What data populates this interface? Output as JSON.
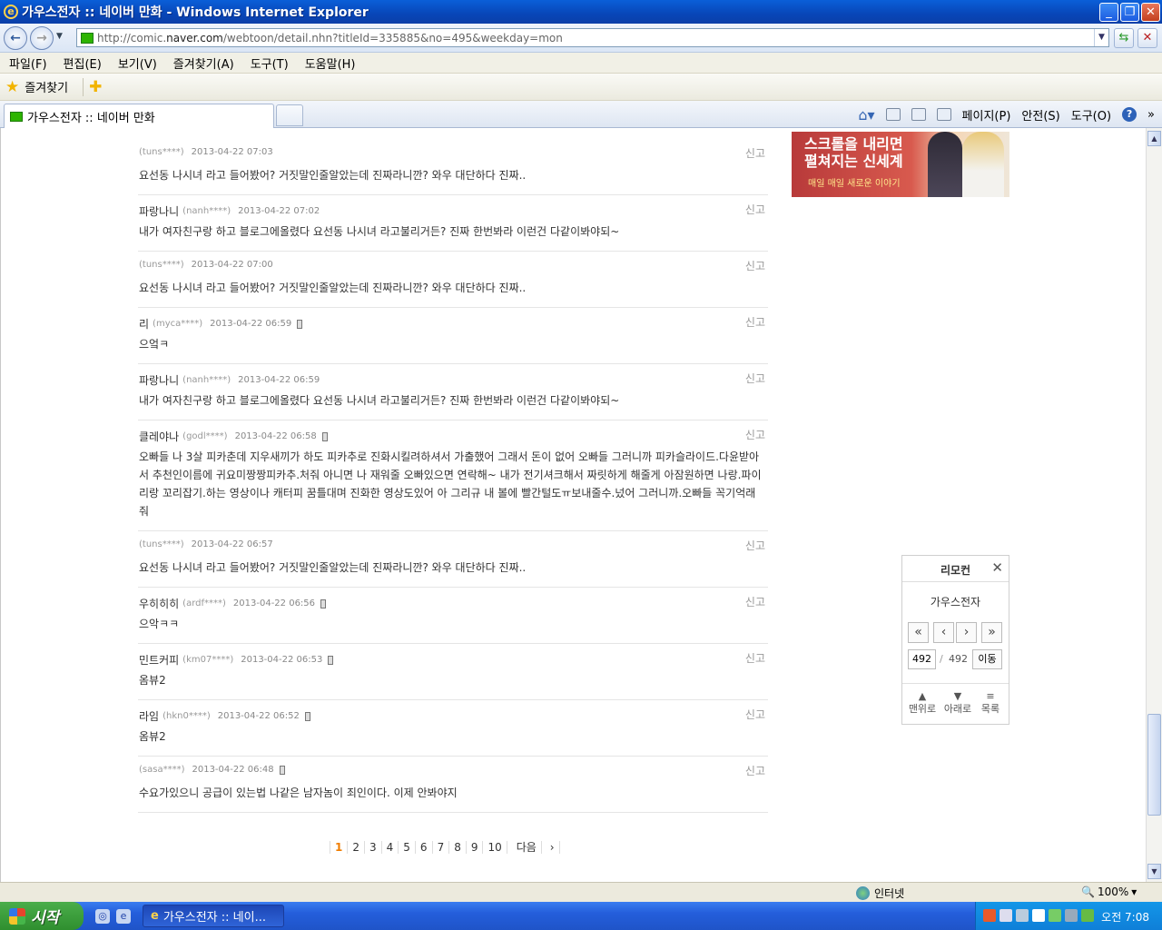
{
  "window": {
    "title": "가우스전자 :: 네이버 만화 - Windows Internet Explorer"
  },
  "address": {
    "url_prefix": "http://comic.",
    "url_domain": "naver.com",
    "url_suffix": "/webtoon/detail.nhn?titleId=335885&no=495&weekday=mon"
  },
  "menu": [
    "파일(F)",
    "편집(E)",
    "보기(V)",
    "즐겨찾기(A)",
    "도구(T)",
    "도움말(H)"
  ],
  "favorites": {
    "label": "즐겨찾기"
  },
  "tab": {
    "title": "가우스전자 :: 네이버 만화"
  },
  "commands": {
    "page": "페이지(P)",
    "safety": "안전(S)",
    "tools": "도구(O)"
  },
  "report_label": "신고",
  "comments": [
    {
      "nick": "",
      "uid": "(tuns****)",
      "date": "2013-04-22 07:03",
      "mobile": false,
      "text": "요선동 나시녀 라고 들어봤어? 거짓말인줄알았는데 진짜라니깐? 와우 대단하다 진짜.."
    },
    {
      "nick": "파랑나니",
      "uid": "(nanh****)",
      "date": "2013-04-22 07:02",
      "mobile": false,
      "text": "내가 여자친구랑 하고 블로그에올렸다 요선동 나시녀 라고불리거든? 진짜 한번봐라 이런건 다같이봐야되~"
    },
    {
      "nick": "",
      "uid": "(tuns****)",
      "date": "2013-04-22 07:00",
      "mobile": false,
      "text": "요선동 나시녀 라고 들어봤어? 거짓말인줄알았는데 진짜라니깐? 와우 대단하다 진짜.."
    },
    {
      "nick": "리",
      "uid": "(myca****)",
      "date": "2013-04-22 06:59",
      "mobile": true,
      "text": "으엌ㅋ"
    },
    {
      "nick": "파랑나니",
      "uid": "(nanh****)",
      "date": "2013-04-22 06:59",
      "mobile": false,
      "text": "내가 여자친구랑 하고 블로그에올렸다 요선동 나시녀 라고불리거든? 진짜 한번봐라 이런건 다같이봐야되~"
    },
    {
      "nick": "클레야나",
      "uid": "(godl****)",
      "date": "2013-04-22 06:58",
      "mobile": true,
      "text": "오빠들 나 3살 피카춘데 지우새끼가 하도 피카추로 진화시킬려하셔서 가출했어 그래서 돈이 없어 오빠들 그러니까 피카슬라이드.다윤받아서 추천인이름에 귀요미짱짱피카추.처줘 아니면 나 재워줄 오빠있으면 연락해~ 내가 전기셔크해서 짜릿하게 해줄게 아잠원하면 나랑.파이리랑 꼬리잡기.하는 영상이나 캐터피 꿈틀대며 진화한 영상도있어 아 그리규 내 볼에 빨간털도ㅠ보내줄수.넜어 그러니까.오빠들 꼭기억래줘"
    },
    {
      "nick": "",
      "uid": "(tuns****)",
      "date": "2013-04-22 06:57",
      "mobile": false,
      "text": "요선동 나시녀 라고 들어봤어? 거짓말인줄알았는데 진짜라니깐? 와우 대단하다 진짜.."
    },
    {
      "nick": "우히히히",
      "uid": "(ardf****)",
      "date": "2013-04-22 06:56",
      "mobile": true,
      "text": "으악ㅋㅋ"
    },
    {
      "nick": "민트커피",
      "uid": "(km07****)",
      "date": "2013-04-22 06:53",
      "mobile": true,
      "text": "옴뷰2"
    },
    {
      "nick": "라임",
      "uid": "(hkn0****)",
      "date": "2013-04-22 06:52",
      "mobile": true,
      "text": "옴뷰2"
    },
    {
      "nick": "",
      "uid": "(sasa****)",
      "date": "2013-04-22 06:48",
      "mobile": true,
      "text": "수요가있으니 공급이 있는법 나같은 남자놈이 죄인이다. 이제 안봐야지"
    }
  ],
  "banner": {
    "line1": "스크롤을 내리면",
    "line2": "펼쳐지는 신세계",
    "line3": "매일 매일 새로운 이야기"
  },
  "remote": {
    "title": "리모컨",
    "comic": "가우스전자",
    "page": "492",
    "total": "492",
    "go": "이동",
    "top": "맨위로",
    "down": "아래로",
    "list": "목록"
  },
  "paging": {
    "pages": [
      "1",
      "2",
      "3",
      "4",
      "5",
      "6",
      "7",
      "8",
      "9",
      "10"
    ],
    "next": "다음"
  },
  "status": {
    "zone": "인터넷",
    "zoom": "100%"
  },
  "taskbar": {
    "start": "시작",
    "task": "가우스전자 :: 네이...",
    "clock": "오전 7:08"
  }
}
